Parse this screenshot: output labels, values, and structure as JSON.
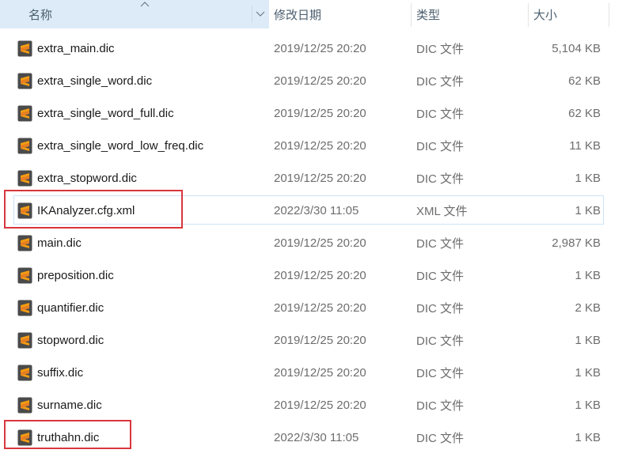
{
  "columns": {
    "name": "名称",
    "date": "修改日期",
    "type": "类型",
    "size": "大小"
  },
  "icons": {
    "file": "sublime-text-file-icon",
    "sort": "sort-ascending-icon",
    "dropdown": "chevron-down-icon"
  },
  "colors": {
    "icon_bg": "#4a4a4a",
    "icon_accent": "#f39c12",
    "header_active": "#dcebf7",
    "annotation": "#d9363e"
  },
  "files": [
    {
      "name": "extra_main.dic",
      "date": "2019/12/25 20:20",
      "type": "DIC 文件",
      "size": "5,104 KB"
    },
    {
      "name": "extra_single_word.dic",
      "date": "2019/12/25 20:20",
      "type": "DIC 文件",
      "size": "62 KB"
    },
    {
      "name": "extra_single_word_full.dic",
      "date": "2019/12/25 20:20",
      "type": "DIC 文件",
      "size": "62 KB"
    },
    {
      "name": "extra_single_word_low_freq.dic",
      "date": "2019/12/25 20:20",
      "type": "DIC 文件",
      "size": "11 KB"
    },
    {
      "name": "extra_stopword.dic",
      "date": "2019/12/25 20:20",
      "type": "DIC 文件",
      "size": "1 KB"
    },
    {
      "name": "IKAnalyzer.cfg.xml",
      "date": "2022/3/30 11:05",
      "type": "XML 文件",
      "size": "1 KB"
    },
    {
      "name": "main.dic",
      "date": "2019/12/25 20:20",
      "type": "DIC 文件",
      "size": "2,987 KB"
    },
    {
      "name": "preposition.dic",
      "date": "2019/12/25 20:20",
      "type": "DIC 文件",
      "size": "1 KB"
    },
    {
      "name": "quantifier.dic",
      "date": "2019/12/25 20:20",
      "type": "DIC 文件",
      "size": "2 KB"
    },
    {
      "name": "stopword.dic",
      "date": "2019/12/25 20:20",
      "type": "DIC 文件",
      "size": "1 KB"
    },
    {
      "name": "suffix.dic",
      "date": "2019/12/25 20:20",
      "type": "DIC 文件",
      "size": "1 KB"
    },
    {
      "name": "surname.dic",
      "date": "2019/12/25 20:20",
      "type": "DIC 文件",
      "size": "1 KB"
    },
    {
      "name": "truthahn.dic",
      "date": "2022/3/30 11:05",
      "type": "DIC 文件",
      "size": "1 KB"
    }
  ]
}
